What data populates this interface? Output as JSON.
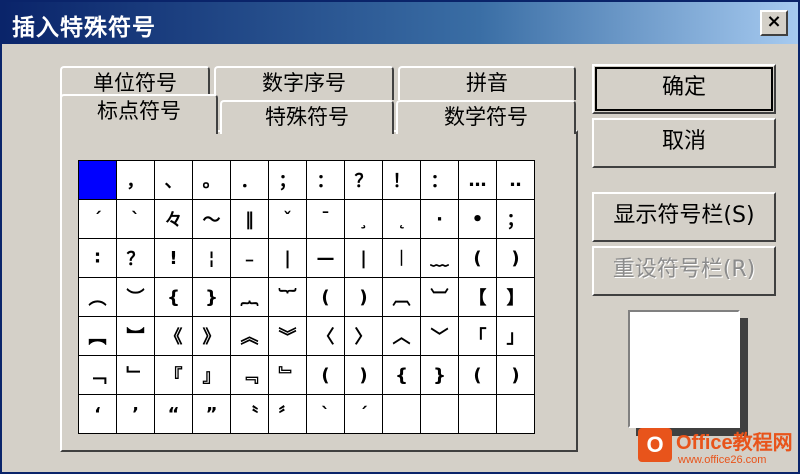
{
  "dialog": {
    "title": "插入特殊符号",
    "close_label": "×"
  },
  "tabs": {
    "back_row": [
      "单位符号",
      "数字序号",
      "拼音"
    ],
    "front_row": [
      "标点符号",
      "特殊符号",
      "数学符号"
    ],
    "active": "标点符号"
  },
  "grid": {
    "rows": [
      [
        "",
        "，",
        "、",
        "。",
        "．",
        "；",
        "：",
        "？",
        "！",
        "：",
        "…",
        "‥"
      ],
      [
        "ˊ",
        "ˋ",
        "々",
        "～",
        "‖",
        "ˇ",
        "ˉ",
        "¸",
        "˛",
        "·",
        "•",
        "；"
      ],
      [
        "∶",
        "？",
        "!",
        "¦",
        "﹣",
        "|",
        "—",
        "|",
        "︱",
        "﹏",
        "(",
        ")"
      ],
      [
        "︵",
        "︶",
        "{",
        "}",
        "︷",
        "︸",
        "(",
        ")",
        "︹",
        "︺",
        "【",
        "】"
      ],
      [
        "︻",
        "︼",
        "《",
        "》",
        "︽",
        "︾",
        "〈",
        "〉",
        "︿",
        "﹀",
        "「",
        "」"
      ],
      [
        "﹁",
        "﹂",
        "『",
        "』",
        "﹃",
        "﹄",
        "(",
        ")",
        "{",
        "}",
        "(",
        ")"
      ],
      [
        "‘",
        "’",
        "“",
        "”",
        "〝",
        "〞",
        "ˋ",
        "ˊ",
        "",
        "",
        "",
        ""
      ]
    ],
    "selected_index": [
      0,
      0
    ]
  },
  "buttons": {
    "ok": "确定",
    "cancel": "取消",
    "show_toolbar": "显示符号栏(S)",
    "reset_toolbar": "重设符号栏(R)"
  },
  "watermark": {
    "logo_letter": "O",
    "title": "Office教程网",
    "url": "www.office26.com"
  },
  "colors": {
    "title_bar": "#0a246a",
    "selected_cell": "#0000ff",
    "dialog_bg": "#d4d0c8",
    "watermark": "#e8541b"
  }
}
